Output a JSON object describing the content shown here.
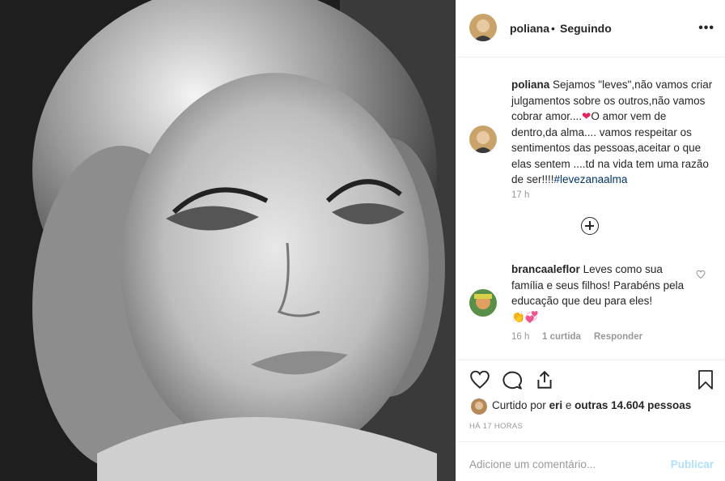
{
  "post": {
    "image_alt": "black and white portrait photo",
    "header": {
      "username": "poliana",
      "separator": "•",
      "follow_status": "Seguindo",
      "more": "•••"
    },
    "caption": {
      "username": "poliana",
      "text_1": "Sejamos \"leves\",não vamos criar julgamentos sobre os outros,não vamos cobrar amor....",
      "text_2": "O amor vem de dentro,da alma.... vamos respeitar os sentimentos das pessoas,aceitar o que elas sentem ....td na vida tem uma razão de ser!!!!",
      "hashtag": "#levezanaalma",
      "time": "17 h"
    },
    "comments": [
      {
        "username": "brancaaleflor",
        "text": "Leves como sua família e seus filhos! Parabéns pela educação que deu para eles!",
        "time": "16 h",
        "likes": "1 curtida",
        "reply": "Responder"
      }
    ],
    "likes": {
      "prefix": "Curtido por",
      "user": "eri",
      "connector": "e",
      "others": "outras 14.604 pessoas"
    },
    "date": "HÁ 17 HORAS",
    "comment_input": {
      "placeholder": "Adicione um comentário...",
      "publish": "Publicar"
    }
  },
  "icons": [
    "heart-icon",
    "comment-icon",
    "share-icon",
    "bookmark-icon",
    "add-circle-icon",
    "more-icon"
  ],
  "colors": {
    "link": "#003569",
    "muted": "#999999",
    "publish_disabled": "#b2dffc",
    "border": "#efefef"
  }
}
